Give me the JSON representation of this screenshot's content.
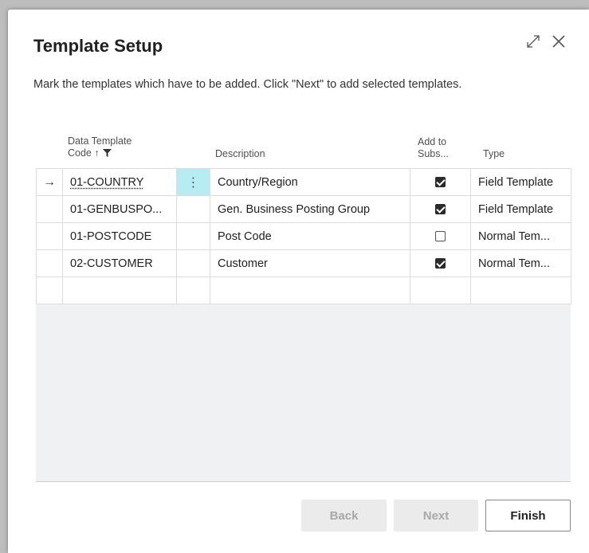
{
  "dialog": {
    "title": "Template Setup",
    "instructions": "Mark the templates which have to be added. Click \"Next\" to add selected templates.",
    "icons": [
      "expand-icon",
      "close-icon"
    ]
  },
  "grid": {
    "columns": {
      "code_line1": "Data Template",
      "code_line2": "Code ↑",
      "description": "Description",
      "add_line1": "Add to",
      "add_line2": "Subs...",
      "type": "Type"
    },
    "rows": [
      {
        "indicator": "→",
        "code": "01-COUNTRY",
        "description": "Country/Region",
        "add": true,
        "type": "Field Template"
      },
      {
        "indicator": "",
        "code": "01-GENBUSPO...",
        "description": "Gen. Business Posting Group",
        "add": true,
        "type": "Field Template"
      },
      {
        "indicator": "",
        "code": "01-POSTCODE",
        "description": "Post Code",
        "add": false,
        "type": "Normal Tem..."
      },
      {
        "indicator": "",
        "code": "02-CUSTOMER",
        "description": "Customer",
        "add": true,
        "type": "Normal Tem..."
      }
    ],
    "menu_glyph": "⋮"
  },
  "buttons": {
    "back": "Back",
    "next": "Next",
    "finish": "Finish"
  }
}
